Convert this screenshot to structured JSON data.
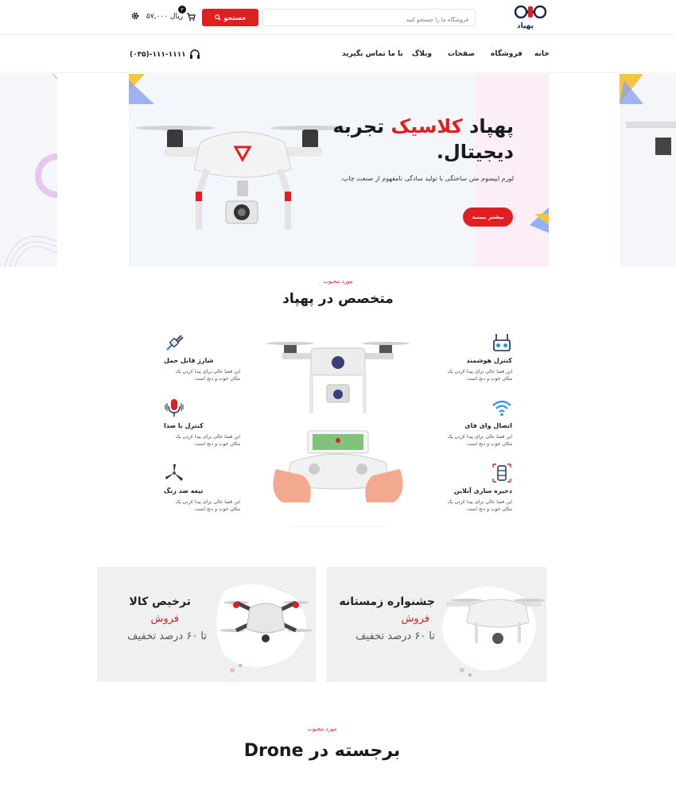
{
  "header": {
    "logo_text": "پهپاد",
    "search_placeholder": "فروشگاه ما را جستجو کنید",
    "search_button": "جستجو",
    "cart_total": "۵۷,۰۰۰ ریال",
    "cart_count": "۳"
  },
  "nav": {
    "items": [
      "خانه",
      "فروشگاه",
      "صفحات",
      "وبلاگ",
      "با ما تماس بگیرید"
    ],
    "phone": "(۰۳۵)-۱۱۱-۱۱۱۱"
  },
  "hero": {
    "title_part1": "پهپاد ",
    "title_accent": "کلاسیک",
    "title_part2": " تجربه",
    "title_line2": "دیجیتال.",
    "description": "لورم ایپسوم متن ساختگی با تولید سادگی نامفهوم از صنعت چاپ.",
    "button": "بیشتر ببینید"
  },
  "experts": {
    "kicker": "مورد محبوب",
    "title": "متخصص در پهپاد",
    "features": [
      {
        "title": "کنترل هوشمند",
        "desc": "این فضا عالی برای پیدا کردن یک مکان خوب و دنج است.",
        "icon": "remote-control-icon"
      },
      {
        "title": "اتصال وای فای",
        "desc": "این فضا عالی برای پیدا کردن یک مکان خوب و دنج است.",
        "icon": "wifi-icon"
      },
      {
        "title": "ذخیره سازی آنلاین",
        "desc": "این فضا عالی برای پیدا کردن یک مکان خوب و دنج است.",
        "icon": "storage-icon"
      },
      {
        "title": "شارژ قابل حمل",
        "desc": "این فضا عالی برای پیدا کردن یک مکان خوب و دنج است.",
        "icon": "plug-icon"
      },
      {
        "title": "کنترل با صدا",
        "desc": "این فضا عالی برای پیدا کردن یک مکان خوب و دنج است.",
        "icon": "microphone-icon"
      },
      {
        "title": "تیغه ضد زنگ",
        "desc": "این فضا عالی برای پیدا کردن یک مکان خوب و دنج است.",
        "icon": "propeller-icon"
      }
    ]
  },
  "promos": [
    {
      "title": "جشنواره زمستانه",
      "sub": "فروش",
      "off": "تا ۶۰ درصد تخفیف"
    },
    {
      "title": "ترخیص کالا",
      "sub": "فروش",
      "off": "تا ۶۰ درصد تخفیف"
    }
  ],
  "featured": {
    "kicker": "مورد محبوب",
    "title": "برجسته در Drone"
  },
  "colors": {
    "accent": "#e02020",
    "dark": "#1a1a1a",
    "hero_bg": "#f3f6fa",
    "promo_bg": "#eef1f0"
  }
}
